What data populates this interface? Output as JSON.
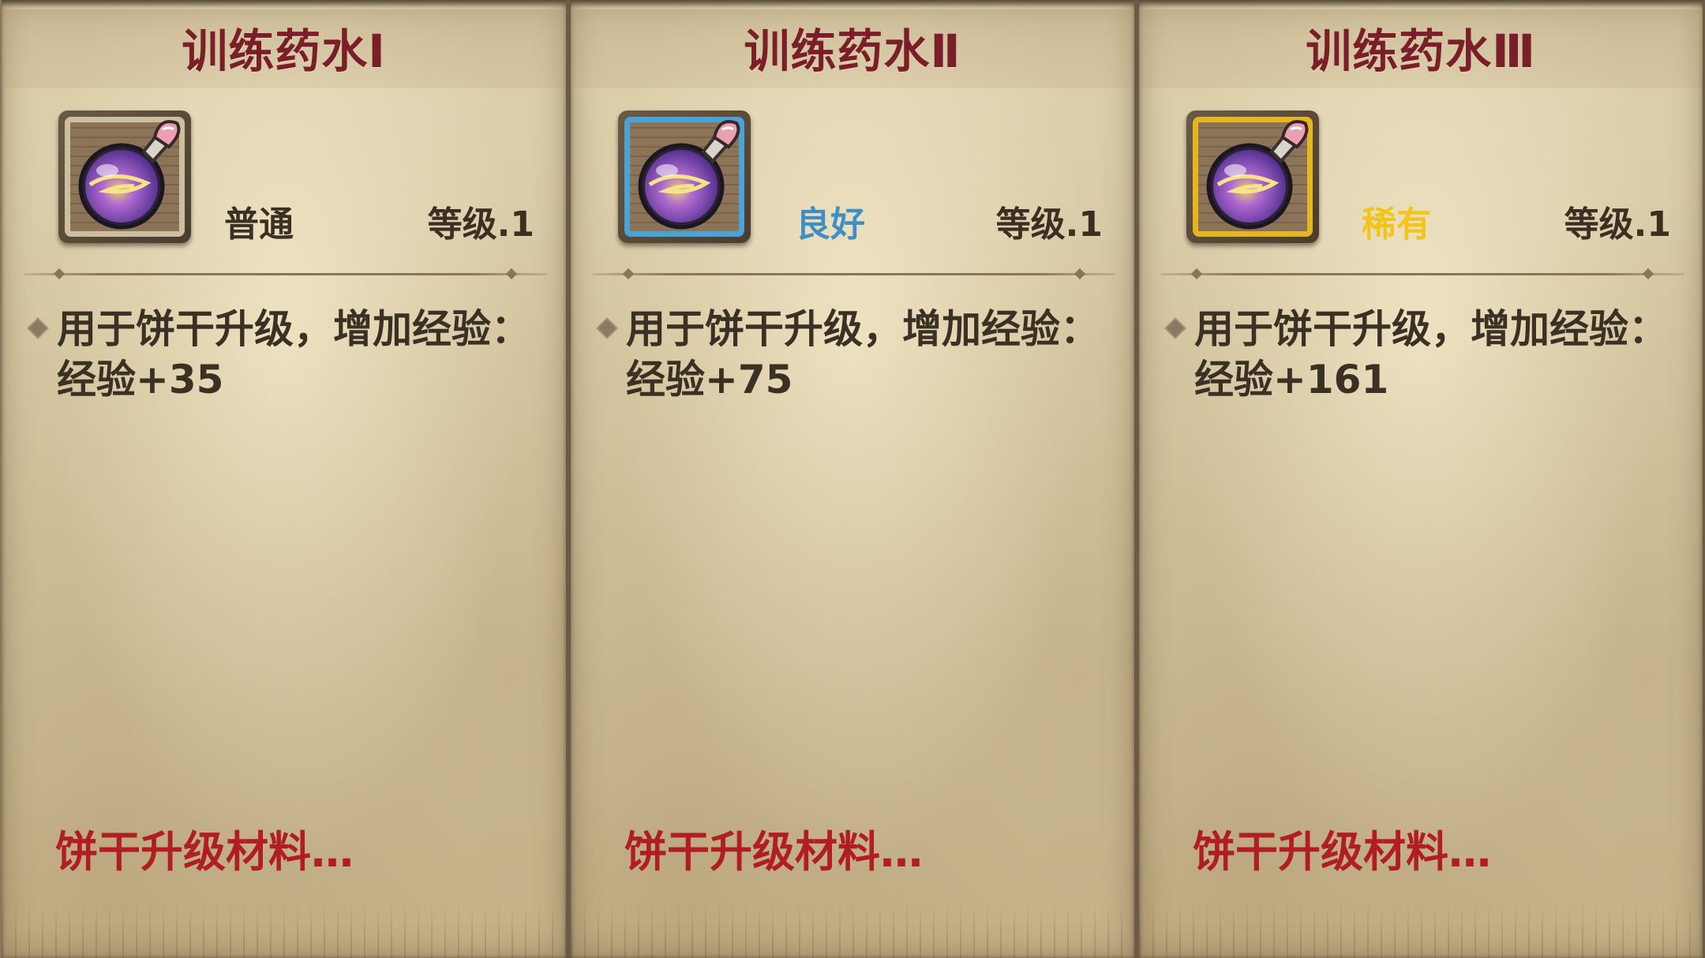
{
  "cards": [
    {
      "title": "训练药水Ⅰ",
      "rarity": "普通",
      "rarity_color": "#3a3024",
      "frame_color": "#cbbf9f",
      "level": "等级.1",
      "desc_line1": "用于饼干升级，增加经验：",
      "desc_line2": "经验+35",
      "footer": "饼干升级材料…",
      "icon": "potion-flask-icon"
    },
    {
      "title": "训练药水Ⅱ",
      "rarity": "良好",
      "rarity_color": "#3d8fc4",
      "frame_color": "#4aa3d6",
      "level": "等级.1",
      "desc_line1": "用于饼干升级，增加经验：",
      "desc_line2": "经验+75",
      "footer": "饼干升级材料…",
      "icon": "potion-flask-icon"
    },
    {
      "title": "训练药水Ⅲ",
      "rarity": "稀有",
      "rarity_color": "#f2c51c",
      "frame_color": "#e6b620",
      "level": "等级.1",
      "desc_line1": "用于饼干升级，增加经验：",
      "desc_line2": "经验+161",
      "footer": "饼干升级材料…",
      "icon": "potion-flask-icon"
    }
  ]
}
